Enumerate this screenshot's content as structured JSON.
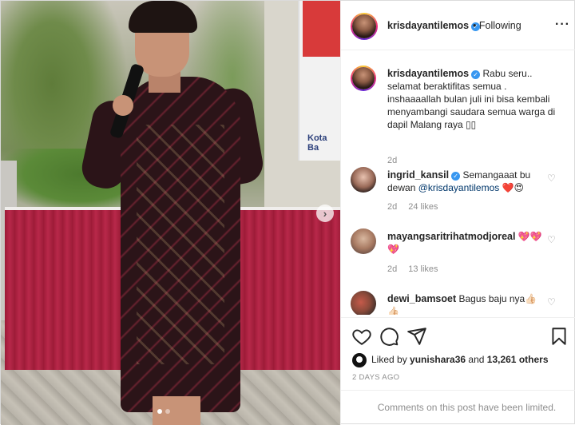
{
  "post": {
    "photo_alt": "Woman in batik dress holding microphone",
    "banner_text": "Kota Ba",
    "carousel": {
      "count": 2,
      "active": 0
    }
  },
  "header": {
    "username": "krisdayantilemos",
    "separator": "•",
    "follow_status": "Following",
    "more_icon": "more-horizontal-icon"
  },
  "caption": {
    "username": "krisdayantilemos",
    "text": "Rabu seru.. selamat beraktifitas semua . inshaaaallah bulan juli ini bisa kembali menyambangi saudara semua warga di dapil Malang raya ",
    "time": "2d"
  },
  "comments": [
    {
      "username": "ingrid_kansil",
      "verified": true,
      "text_before": "Semangaaat bu dewan ",
      "mention": "@krisdayantilemos",
      "emoji": "❤️😍",
      "time": "2d",
      "likes": "24 likes"
    },
    {
      "username": "mayangsaritrihatmodjoreal",
      "verified": false,
      "text_before": "💖💖 💖",
      "mention": "",
      "emoji": "",
      "time": "2d",
      "likes": "13 likes"
    },
    {
      "username": "dewi_bamsoet",
      "verified": false,
      "text_before": "Bagus baju nya👍🏻 👍🏻",
      "mention": "",
      "emoji": "",
      "time": "",
      "likes": ""
    }
  ],
  "actions": {
    "like_icon": "heart-icon",
    "comment_icon": "comment-icon",
    "share_icon": "share-icon",
    "save_icon": "bookmark-icon"
  },
  "likes": {
    "prefix": "Liked by ",
    "user": "yunishara36",
    "middle": " and ",
    "others": "13,261 others"
  },
  "posted_ago": "2 DAYS AGO",
  "comments_limited": "Comments on this post have been limited."
}
